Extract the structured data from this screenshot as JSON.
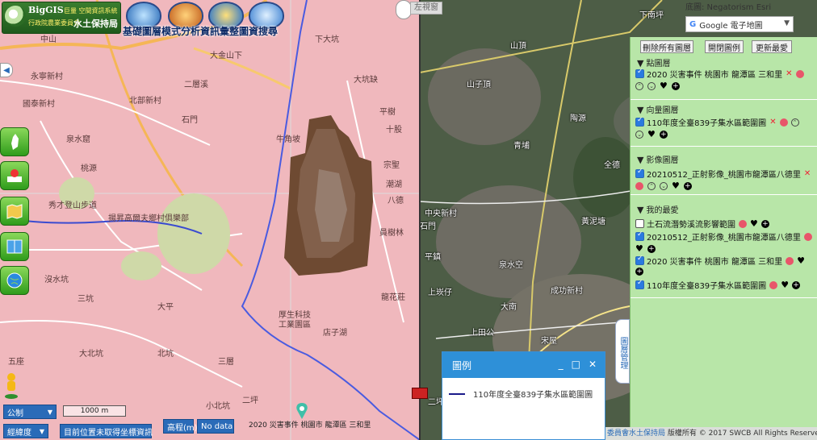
{
  "header": {
    "logo_line1": "BigGIS",
    "logo_line1b": "巨量 空間資訊系統",
    "logo_line2": "行政院農業委員會",
    "logo_line2b": "水土保持局",
    "title": "基礎圖層模式分析資訊彙整圖資搜尋"
  },
  "swipe": {
    "left_view_label": "左視窗"
  },
  "basemap": {
    "label": "底圖: Negatorism Esri",
    "selected": "Google 電子地圖"
  },
  "panel": {
    "buttons": [
      "刪除所有圖層",
      "開閉圖例",
      "更新最愛"
    ],
    "sections": [
      {
        "title": "點圖層",
        "items": [
          {
            "label": "2020 災害事件 桃園市 龍潭區 三和里",
            "checked": true
          }
        ]
      },
      {
        "title": "向量圖層",
        "items": [
          {
            "label": "110年度全臺839子集水區範圍圖",
            "checked": true
          }
        ]
      },
      {
        "title": "影像圖層",
        "items": [
          {
            "label": "20210512_正射影像_桃園市龍潭區八德里",
            "checked": true
          }
        ]
      },
      {
        "title": "我的最愛",
        "items": [
          {
            "label": "土石流潛勢溪流影響範圍",
            "checked": false
          },
          {
            "label": "20210512_正射影像_桃園市龍潭區八德里",
            "checked": true
          },
          {
            "label": "2020 災害事件 桃園市 龍潭區 三和里",
            "checked": true
          },
          {
            "label": "110年度全臺839子集水區範圍圖",
            "checked": true
          }
        ]
      }
    ],
    "side_tab": "圖層管理"
  },
  "legend": {
    "title": "圖例",
    "item_label": "110年度全臺839子集水區範圍圖",
    "line_color": "#1a1a8a"
  },
  "bottom": {
    "unit_select": "公制",
    "scale_label": "1000 m",
    "coord_select": "經緯度",
    "position_text": "目前位置未取得坐標資訊",
    "elevation_label": "高程(m)",
    "elevation_value": "No data",
    "marker_label": "2020 災害事件 桃園市 龍潭區 三和里",
    "copyright_prefix": "委員會水土保持局",
    "copyright_suffix": " 版權所有 © 2017 SWCB All Rights Reserved."
  },
  "map_labels_left": [
    "中山",
    "永寧新村",
    "大金山下",
    "大坑缺",
    "國泰新村",
    "北部新村",
    "二層溪",
    "牛角坡",
    "泉水窟",
    "石門",
    "桃源",
    "秀才登山步道",
    "揚昇高爾夫鄉村俱樂部",
    "沒水坑",
    "三坑",
    "大平",
    "厚生科技",
    "工業園區",
    "店子湖",
    "大北坑",
    "北坑",
    "小北坑",
    "二坪",
    "八德",
    "潮湖",
    "宗聖",
    "員樹林",
    "龍花莊",
    "平樹",
    "十股",
    "下大坑",
    "三層",
    "五座"
  ],
  "map_labels_right": [
    "山頂",
    "山子頂",
    "下南坪",
    "陶源",
    "青埔",
    "全德",
    "中央新村",
    "石門",
    "黃泥塘",
    "平鎮",
    "泉水空",
    "成功新村",
    "上崁仔",
    "大南",
    "上田公",
    "宋屋",
    "二坪"
  ],
  "colors": {
    "map_pink": "#f0b8bd",
    "panel_green": "#b8e6a8",
    "accent_blue": "#2a6bb8"
  }
}
